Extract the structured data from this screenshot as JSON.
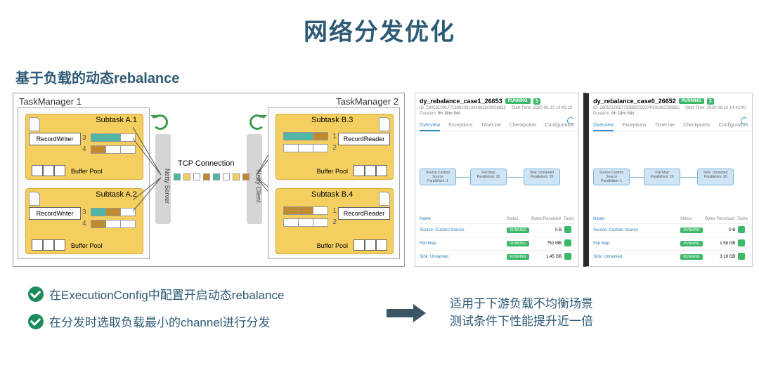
{
  "title": "网络分发优化",
  "subtitle": "基于负载的动态rebalance",
  "diagram": {
    "task_manager_left": "TaskManager 1",
    "task_manager_right": "TaskManager 2",
    "subtask_a1": "Subtask A.1",
    "subtask_a2": "Subtask A.2",
    "subtask_b3": "Subtask B.3",
    "subtask_b4": "Subtask B.4",
    "record_writer": "RecordWriter",
    "record_reader": "RecordReader",
    "buffer_pool": "Buffer Pool",
    "netty_server": "Netty Server",
    "netty_client": "Netty Client",
    "tcp_label": "TCP Connection",
    "ch": {
      "c1": "1",
      "c2": "2",
      "c3": "3",
      "c4": "4"
    }
  },
  "dashboards": [
    {
      "name": "dy_rebalance_case1_26653",
      "status": "RUNNING",
      "count": "3",
      "meta": {
        "id_label": "ID:",
        "id_value": "2805310917713882081334862508026852",
        "start_label": "Start Time:",
        "start_value": "2020-06-10 14:43:19",
        "dur_label": "Duration:",
        "dur_value": "0h 18m 54s"
      },
      "tabs": [
        "Overview",
        "Exceptions",
        "TimeLine",
        "Checkpoints",
        "Configuration"
      ],
      "nodes": [
        {
          "label": "Source Custom Source",
          "sub": "Parallelism: 1"
        },
        {
          "label": "Flat Map",
          "sub": "Parallelism: 20"
        },
        {
          "label": "Sink: Unnamed",
          "sub": "Parallelism: 20"
        }
      ],
      "table_head": {
        "name": "Name",
        "status": "Status",
        "bytes": "Bytes Received",
        "tasks": "Tasks"
      },
      "rows": [
        {
          "name": "Source: Custom Source",
          "status": "RUNNING",
          "bytes": "0 B"
        },
        {
          "name": "Flat Map",
          "status": "RUNNING",
          "bytes": "752 MB"
        },
        {
          "name": "Sink: Unnamed",
          "status": "RUNNING",
          "bytes": "1.45 GB"
        }
      ]
    },
    {
      "name": "dy_rebalance_case0_26652",
      "status": "RUNNING",
      "count": "3",
      "meta": {
        "id_label": "ID:",
        "id_value": "2805210917713882020974008392236852",
        "start_label": "Start Time:",
        "start_value": "2020-06-10 14:42:40",
        "dur_label": "Duration:",
        "dur_value": "0h 18m 54s"
      },
      "tabs": [
        "Overview",
        "Exceptions",
        "TimeLine",
        "Checkpoints",
        "Configuration"
      ],
      "nodes": [
        {
          "label": "Source Custom Source",
          "sub": "Parallelism: 1"
        },
        {
          "label": "Flat Map",
          "sub": "Parallelism: 20"
        },
        {
          "label": "Sink: Unnamed",
          "sub": "Parallelism: 20"
        }
      ],
      "table_head": {
        "name": "Name",
        "status": "Status",
        "bytes": "Bytes Received",
        "tasks": "Tasks"
      },
      "rows": [
        {
          "name": "Source: Custom Source",
          "status": "RUNNING",
          "bytes": "0 B"
        },
        {
          "name": "Flat Map",
          "status": "RUNNING",
          "bytes": "1.58 GB"
        },
        {
          "name": "Sink: Unnamed",
          "status": "RUNNING",
          "bytes": "3.19 GB"
        }
      ]
    }
  ],
  "footer": {
    "point1": "在ExecutionConfig中配置开启动态rebalance",
    "point2": "在分发时选取负载最小的channel进行分发",
    "right1": "适用于下游负载不均衡场景",
    "right2": "测试条件下性能提升近一倍"
  }
}
